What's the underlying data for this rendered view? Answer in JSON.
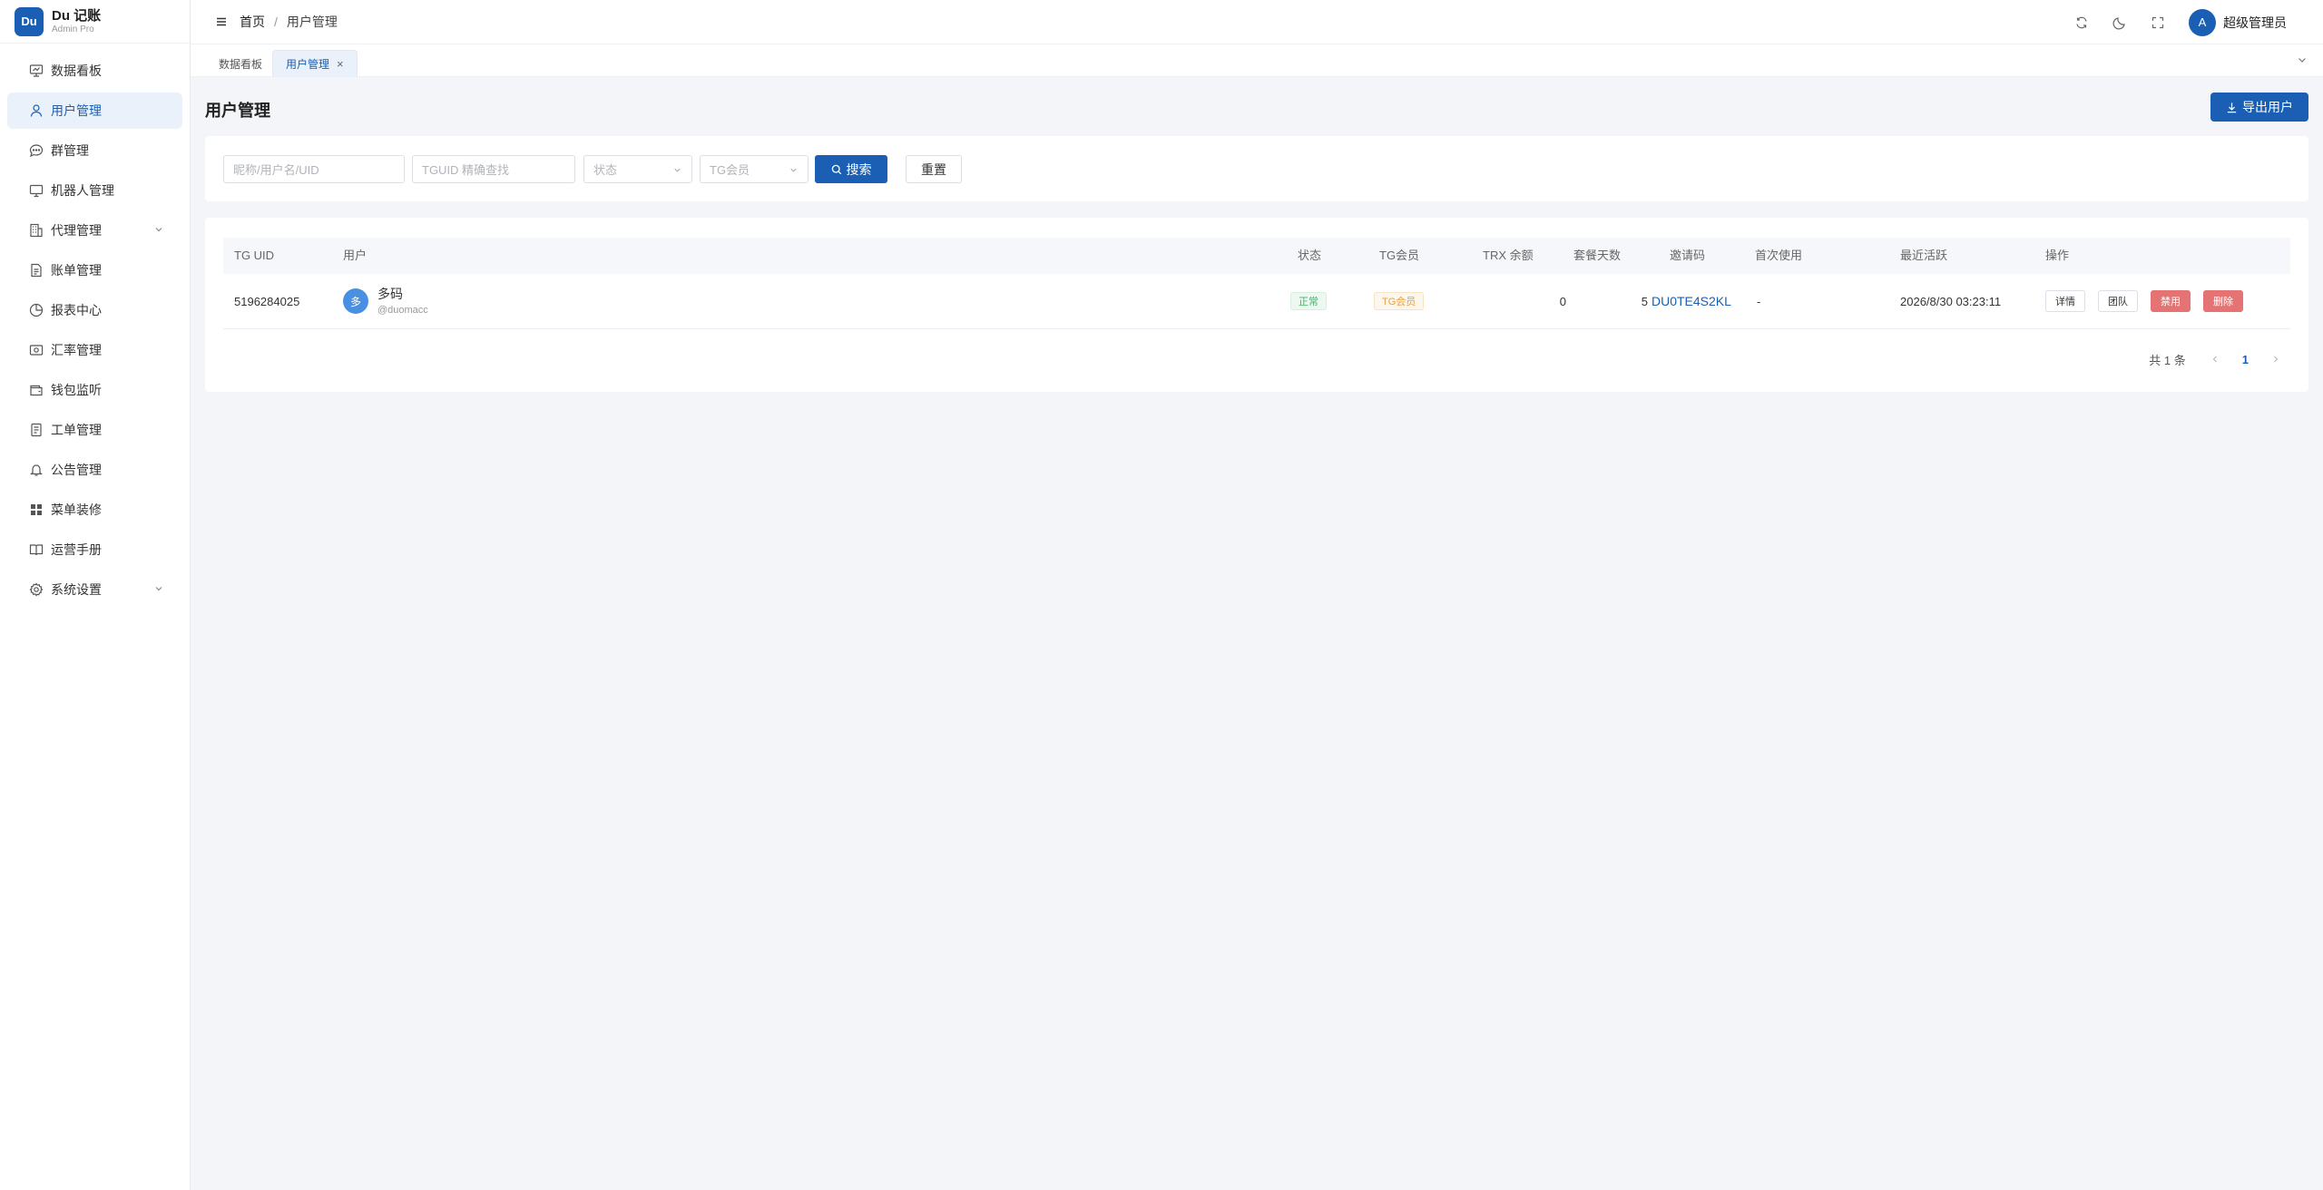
{
  "brand": {
    "logo": "Du",
    "name": "Du 记账",
    "sub": "Admin Pro"
  },
  "sidebar": {
    "items": [
      {
        "label": "数据看板",
        "icon": "dashboard-icon"
      },
      {
        "label": "用户管理",
        "icon": "user-icon",
        "active": true
      },
      {
        "label": "群管理",
        "icon": "chat-icon"
      },
      {
        "label": "机器人管理",
        "icon": "monitor-icon"
      },
      {
        "label": "代理管理",
        "icon": "building-icon",
        "expandable": true
      },
      {
        "label": "账单管理",
        "icon": "file-icon"
      },
      {
        "label": "报表中心",
        "icon": "pie-chart-icon"
      },
      {
        "label": "汇率管理",
        "icon": "money-icon"
      },
      {
        "label": "钱包监听",
        "icon": "wallet-icon"
      },
      {
        "label": "工单管理",
        "icon": "ticket-icon"
      },
      {
        "label": "公告管理",
        "icon": "bell-icon"
      },
      {
        "label": "菜单装修",
        "icon": "grid-icon"
      },
      {
        "label": "运营手册",
        "icon": "book-icon"
      },
      {
        "label": "系统设置",
        "icon": "gear-icon",
        "expandable": true
      }
    ]
  },
  "header": {
    "breadcrumb": {
      "home": "首页",
      "sep": "/",
      "current": "用户管理"
    },
    "avatar_letter": "A",
    "user_name": "超级管理员"
  },
  "tabs": [
    {
      "label": "数据看板",
      "active": false
    },
    {
      "label": "用户管理",
      "active": true,
      "close": "×"
    }
  ],
  "main": {
    "title": "用户管理",
    "export_label": "导出用户"
  },
  "filters": {
    "keyword_placeholder": "昵称/用户名/UID",
    "tguid_placeholder": "TGUID 精确查找",
    "status_placeholder": "状态",
    "tgmember_placeholder": "TG会员",
    "search_label": "搜索",
    "reset_label": "重置"
  },
  "table": {
    "columns": [
      "TG UID",
      "用户",
      "状态",
      "TG会员",
      "TRX 余额",
      "套餐天数",
      "邀请码",
      "首次使用",
      "最近活跃",
      "操作"
    ],
    "rows": [
      {
        "tg_uid": "5196284025",
        "avatar": "多",
        "name": "多码",
        "handle": "@duomacc",
        "status": "正常",
        "tg_member": "TG会员",
        "trx": "0",
        "days": "5",
        "invite_code": "DU0TE4S2KL",
        "first_use": "-",
        "last_active": "2026/8/30 03:23:11",
        "actions": [
          "详情",
          "团队",
          "禁用",
          "删除"
        ]
      }
    ]
  },
  "pager": {
    "total": "共 1 条",
    "page": "1"
  },
  "colors": {
    "primary": "#1a5fb4",
    "danger": "#e57373",
    "success": "#45b36b",
    "warning": "#e6a23c"
  }
}
